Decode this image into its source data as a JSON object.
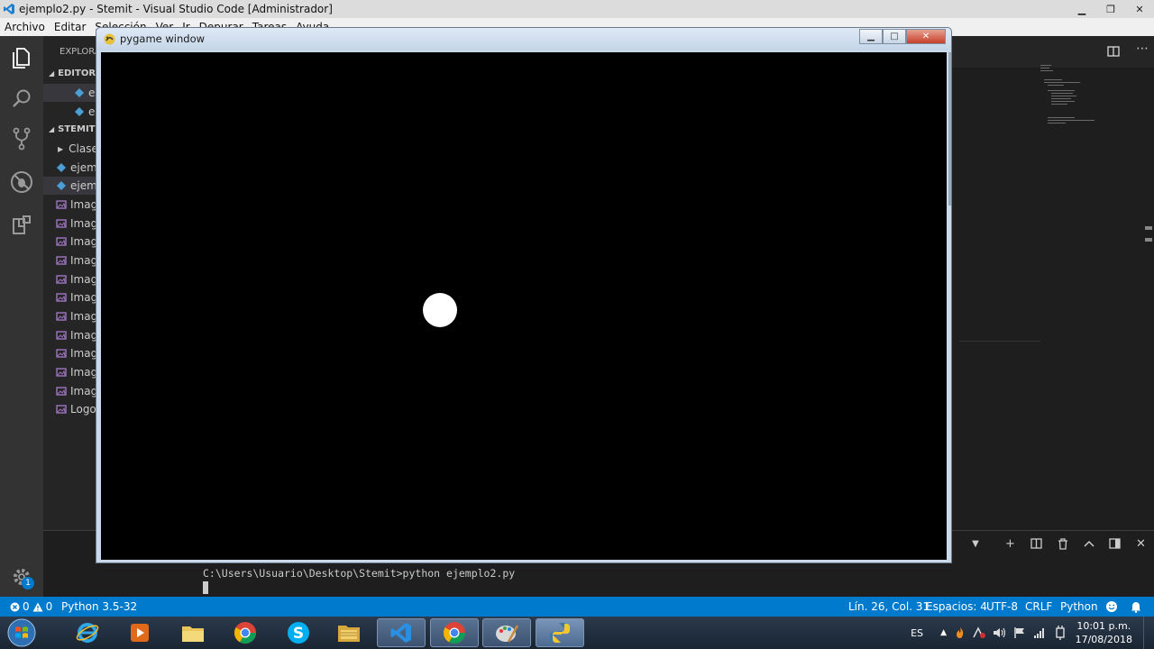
{
  "vscode": {
    "title": "ejemplo2.py - Stemit - Visual Studio Code [Administrador]",
    "menu": [
      "Archivo",
      "Editar",
      "Selección",
      "Ver",
      "Ir",
      "Depurar",
      "Tareas",
      "Ayuda"
    ],
    "sidebar": {
      "header": "EXPLORADOR",
      "open_editors_label": "EDITORES ABIERTOS",
      "open_editors": [
        "e",
        "e"
      ],
      "project_label": "STEMIT",
      "items": [
        {
          "label": "Clase",
          "kind": "folder"
        },
        {
          "label": "ejem",
          "kind": "python"
        },
        {
          "label": "ejem",
          "kind": "python",
          "selected": true
        },
        {
          "label": "Imag",
          "kind": "image"
        },
        {
          "label": "Imag",
          "kind": "image"
        },
        {
          "label": "Imag",
          "kind": "image"
        },
        {
          "label": "Imag",
          "kind": "image"
        },
        {
          "label": "Imag",
          "kind": "image"
        },
        {
          "label": "Imag",
          "kind": "image"
        },
        {
          "label": "Imag",
          "kind": "image"
        },
        {
          "label": "Imag",
          "kind": "image"
        },
        {
          "label": "Imag",
          "kind": "image"
        },
        {
          "label": "Imag",
          "kind": "image"
        },
        {
          "label": "Imag",
          "kind": "image"
        },
        {
          "label": "Logo",
          "kind": "image"
        }
      ]
    },
    "activity_badge": "1",
    "terminal": {
      "command_line": "C:\\Users\\Usuario\\Desktop\\Stemit>python ejemplo2.py"
    },
    "status": {
      "errors": "0",
      "warnings": "0",
      "interpreter": "Python 3.5-32",
      "position": "Lín. 26, Col. 31",
      "spaces": "Espacios: 4",
      "encoding": "UTF-8",
      "eol": "CRLF",
      "language": "Python"
    }
  },
  "pygame": {
    "title": "pygame window",
    "canvas_color": "#000000",
    "ball_color": "#ffffff"
  },
  "taskbar": {
    "apps": [
      "internet-explorer",
      "media-player",
      "file-manager",
      "chrome",
      "skype",
      "explorer",
      "vscode",
      "chrome-alt",
      "paint",
      "python"
    ],
    "language": "ES",
    "time": "10:01 p.m.",
    "date": "17/08/2018"
  },
  "colors": {
    "status_bar": "#007acc",
    "activity_bar": "#333333",
    "sidebar": "#252526",
    "editor": "#1e1e1e"
  }
}
